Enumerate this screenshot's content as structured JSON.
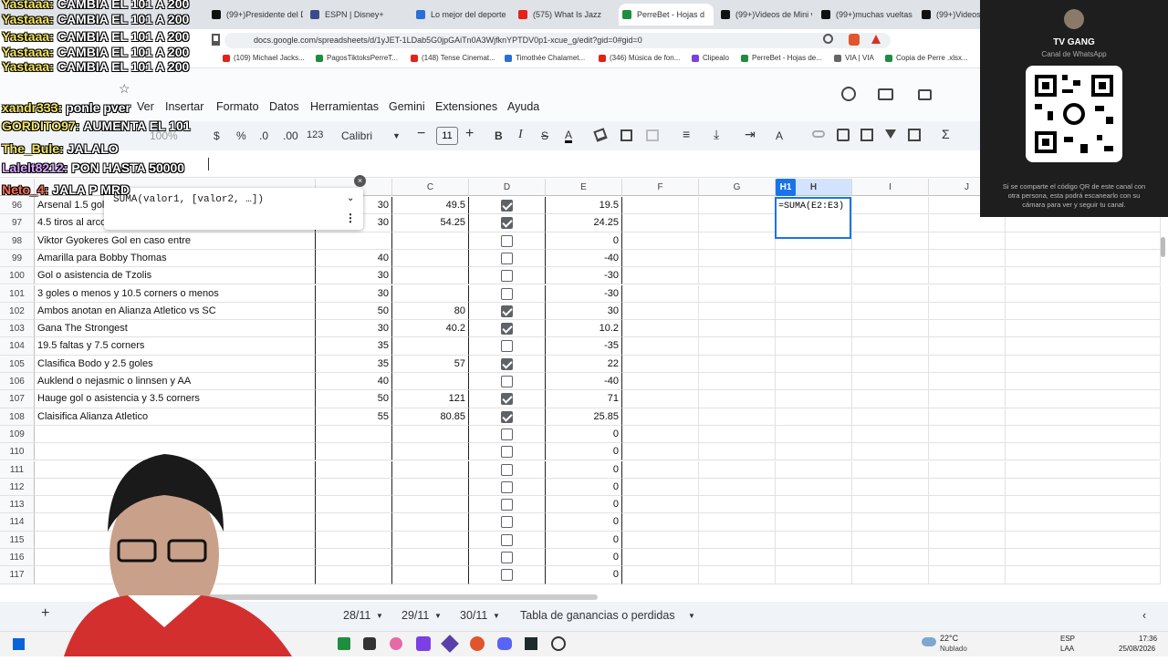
{
  "browser": {
    "tabs": [
      {
        "label": "(99+)Presidente del D",
        "color": "#111"
      },
      {
        "label": "ESPN | Disney+",
        "color": "#3b4b8a"
      },
      {
        "label": "Lo mejor del deporte",
        "color": "#2b6fd6"
      },
      {
        "label": "(575) What Is Jazz",
        "color": "#e62117"
      },
      {
        "label": "PerreBet - Hojas d",
        "color": "#1e8e3e"
      },
      {
        "label": "(99+)Videos de Mini v",
        "color": "#111"
      },
      {
        "label": "(99+)muchas vueltas p",
        "color": "#111"
      },
      {
        "label": "(99+)Videos",
        "color": "#111"
      }
    ],
    "url": "docs.google.com/spreadsheets/d/1yJET-1LDab5G0jpGAiTn0A3WjfknYPTDV0p1-xcue_g/edit?gid=0#gid=0",
    "bookmarks": [
      {
        "label": "(109) Michael Jacks...",
        "color": "#e62117"
      },
      {
        "label": "PagosTiktoksPerreT...",
        "color": "#1e8e3e"
      },
      {
        "label": "(148) Tense Cinemat...",
        "color": "#e62117"
      },
      {
        "label": "Timothée Chalamet...",
        "color": "#2b6fd6"
      },
      {
        "label": "(346) Música de fon...",
        "color": "#e62117"
      },
      {
        "label": "Clipealo",
        "color": "#7b3fe4"
      },
      {
        "label": "PerreBet - Hojas de...",
        "color": "#1e8e3e"
      },
      {
        "label": "VIA | VIA",
        "color": "#666"
      },
      {
        "label": "Copia de Perre .xlsx...",
        "color": "#1e8e3e"
      }
    ]
  },
  "sheets": {
    "menus": [
      "Ver",
      "Insertar",
      "Formato",
      "Datos",
      "Herramientas",
      "Gemini",
      "Extensiones",
      "Ayuda"
    ],
    "toolbar": {
      "zoom": "100%",
      "currency": "$",
      "percent": "%",
      "dec_less": ".0",
      "dec_more": ".00",
      "format": "123",
      "font": "Calibri",
      "size": "11"
    },
    "namebox": "H1",
    "active_col": "H",
    "tooltip_signature": "SUMA(valor1, [valor2, …])",
    "formula": "=SUMA(E2:E3)",
    "col_headers": [
      "C",
      "D",
      "E",
      "F",
      "G",
      "H",
      "I",
      "J"
    ],
    "rows": [
      {
        "num": "96",
        "a": "Arsenal 1.5 goles",
        "b": "30",
        "c": "49.5",
        "d": true,
        "e": "19.5"
      },
      {
        "num": "97",
        "a": "4.5 tiros al arco",
        "b": "30",
        "c": "54.25",
        "d": true,
        "e": "24.25"
      },
      {
        "num": "98",
        "a": "Viktor Gyokeres Gol en caso entre",
        "b": "",
        "c": "",
        "d": false,
        "e": "0"
      },
      {
        "num": "99",
        "a": "Amarilla para Bobby Thomas",
        "b": "40",
        "c": "",
        "d": false,
        "e": "-40"
      },
      {
        "num": "100",
        "a": "Gol o asistencia de Tzolis",
        "b": "30",
        "c": "",
        "d": false,
        "e": "-30"
      },
      {
        "num": "101",
        "a": "3 goles o menos y 10.5 corners o menos",
        "b": "30",
        "c": "",
        "d": false,
        "e": "-30"
      },
      {
        "num": "102",
        "a": "Ambos anotan en Alianza Atletico vs SC",
        "b": "50",
        "c": "80",
        "d": true,
        "e": "30"
      },
      {
        "num": "103",
        "a": "Gana The Strongest",
        "b": "30",
        "c": "40.2",
        "d": true,
        "e": "10.2"
      },
      {
        "num": "104",
        "a": "19.5 faltas y 7.5 corners",
        "b": "35",
        "c": "",
        "d": false,
        "e": "-35"
      },
      {
        "num": "105",
        "a": "Clasifica Bodo y 2.5 goles",
        "b": "35",
        "c": "57",
        "d": true,
        "e": "22"
      },
      {
        "num": "106",
        "a": "Auklend o nejasmic o linnsen y AA",
        "b": "40",
        "c": "",
        "d": false,
        "e": "-40"
      },
      {
        "num": "107",
        "a": "Hauge gol o asistencia y 3.5 corners",
        "b": "50",
        "c": "121",
        "d": true,
        "e": "71"
      },
      {
        "num": "108",
        "a": "Claisifica Alianza Atletico",
        "b": "55",
        "c": "80.85",
        "d": true,
        "e": "25.85"
      },
      {
        "num": "109",
        "a": "",
        "b": "",
        "c": "",
        "d": false,
        "e": "0"
      },
      {
        "num": "110",
        "a": "",
        "b": "",
        "c": "",
        "d": false,
        "e": "0"
      },
      {
        "num": "111",
        "a": "",
        "b": "",
        "c": "",
        "d": false,
        "e": "0"
      },
      {
        "num": "112",
        "a": "",
        "b": "",
        "c": "",
        "d": false,
        "e": "0"
      },
      {
        "num": "113",
        "a": "",
        "b": "",
        "c": "",
        "d": false,
        "e": "0"
      },
      {
        "num": "114",
        "a": "",
        "b": "",
        "c": "",
        "d": false,
        "e": "0"
      },
      {
        "num": "115",
        "a": "",
        "b": "",
        "c": "",
        "d": false,
        "e": "0"
      },
      {
        "num": "116",
        "a": "",
        "b": "",
        "c": "",
        "d": false,
        "e": "0"
      },
      {
        "num": "117",
        "a": "",
        "b": "",
        "c": "",
        "d": false,
        "e": "0"
      }
    ],
    "sheet_tabs": [
      "28/11",
      "29/11",
      "30/11",
      "Tabla de ganancias o perdidas"
    ]
  },
  "whatsapp_panel": {
    "title": "TV GANG",
    "subtitle": "Canal de WhatsApp",
    "note": "Si se comparte el código QR de este canal con otra persona, esta podrá escanearlo con su cámara para ver y seguir tu canal."
  },
  "chat": [
    {
      "user": "Yastaaa:",
      "msg": "CAMBIA EL 101 A 200",
      "cls": ""
    },
    {
      "user": "Yastaaa:",
      "msg": "CAMBIA EL 101 A 200",
      "cls": ""
    },
    {
      "user": "Yastaaa:",
      "msg": "CAMBIA EL 101 A 200",
      "cls": ""
    },
    {
      "user": "Yastaaa:",
      "msg": "CAMBIA EL 101 A 200",
      "cls": ""
    },
    {
      "user": "Yastaaa:",
      "msg": "CAMBIA EL 101 A 200",
      "cls": ""
    },
    {
      "user": "xandr333:",
      "msg": "ponle pver",
      "cls": ""
    },
    {
      "user": "GORDITO97:",
      "msg": "AUMENTA EL 101",
      "cls": ""
    },
    {
      "user": "The_Bule:",
      "msg": "JALALO",
      "cls": ""
    },
    {
      "user": "Lalelt8212:",
      "msg": "PON HASTA 50000",
      "cls": "purple"
    },
    {
      "user": "Neto_4:",
      "msg": "JALA P MRD",
      "cls": "red"
    }
  ],
  "taskbar": {
    "temp": "22°C",
    "weather": "Nublado",
    "lang": "ESP",
    "layout": "LAA",
    "time": "17:36",
    "date": "25/08/2026"
  }
}
